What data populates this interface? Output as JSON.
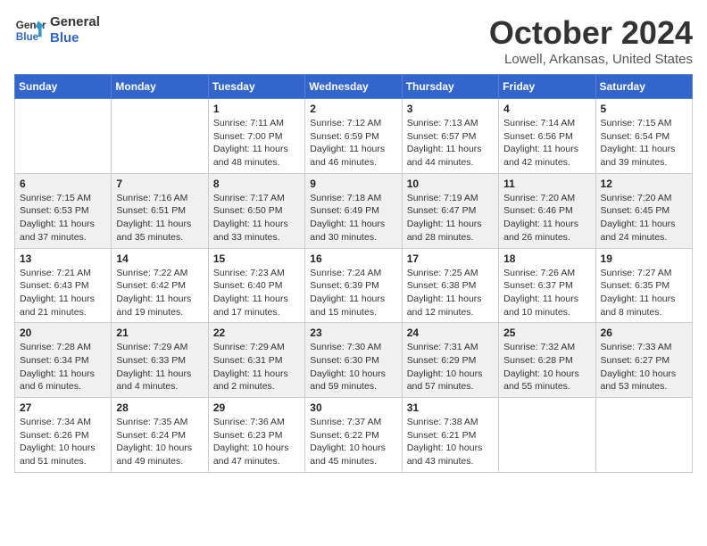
{
  "header": {
    "logo_line1": "General",
    "logo_line2": "Blue",
    "month": "October 2024",
    "location": "Lowell, Arkansas, United States"
  },
  "weekdays": [
    "Sunday",
    "Monday",
    "Tuesday",
    "Wednesday",
    "Thursday",
    "Friday",
    "Saturday"
  ],
  "weeks": [
    [
      {
        "day": "",
        "sunrise": "",
        "sunset": "",
        "daylight": ""
      },
      {
        "day": "",
        "sunrise": "",
        "sunset": "",
        "daylight": ""
      },
      {
        "day": "1",
        "sunrise": "Sunrise: 7:11 AM",
        "sunset": "Sunset: 7:00 PM",
        "daylight": "Daylight: 11 hours and 48 minutes."
      },
      {
        "day": "2",
        "sunrise": "Sunrise: 7:12 AM",
        "sunset": "Sunset: 6:59 PM",
        "daylight": "Daylight: 11 hours and 46 minutes."
      },
      {
        "day": "3",
        "sunrise": "Sunrise: 7:13 AM",
        "sunset": "Sunset: 6:57 PM",
        "daylight": "Daylight: 11 hours and 44 minutes."
      },
      {
        "day": "4",
        "sunrise": "Sunrise: 7:14 AM",
        "sunset": "Sunset: 6:56 PM",
        "daylight": "Daylight: 11 hours and 42 minutes."
      },
      {
        "day": "5",
        "sunrise": "Sunrise: 7:15 AM",
        "sunset": "Sunset: 6:54 PM",
        "daylight": "Daylight: 11 hours and 39 minutes."
      }
    ],
    [
      {
        "day": "6",
        "sunrise": "Sunrise: 7:15 AM",
        "sunset": "Sunset: 6:53 PM",
        "daylight": "Daylight: 11 hours and 37 minutes."
      },
      {
        "day": "7",
        "sunrise": "Sunrise: 7:16 AM",
        "sunset": "Sunset: 6:51 PM",
        "daylight": "Daylight: 11 hours and 35 minutes."
      },
      {
        "day": "8",
        "sunrise": "Sunrise: 7:17 AM",
        "sunset": "Sunset: 6:50 PM",
        "daylight": "Daylight: 11 hours and 33 minutes."
      },
      {
        "day": "9",
        "sunrise": "Sunrise: 7:18 AM",
        "sunset": "Sunset: 6:49 PM",
        "daylight": "Daylight: 11 hours and 30 minutes."
      },
      {
        "day": "10",
        "sunrise": "Sunrise: 7:19 AM",
        "sunset": "Sunset: 6:47 PM",
        "daylight": "Daylight: 11 hours and 28 minutes."
      },
      {
        "day": "11",
        "sunrise": "Sunrise: 7:20 AM",
        "sunset": "Sunset: 6:46 PM",
        "daylight": "Daylight: 11 hours and 26 minutes."
      },
      {
        "day": "12",
        "sunrise": "Sunrise: 7:20 AM",
        "sunset": "Sunset: 6:45 PM",
        "daylight": "Daylight: 11 hours and 24 minutes."
      }
    ],
    [
      {
        "day": "13",
        "sunrise": "Sunrise: 7:21 AM",
        "sunset": "Sunset: 6:43 PM",
        "daylight": "Daylight: 11 hours and 21 minutes."
      },
      {
        "day": "14",
        "sunrise": "Sunrise: 7:22 AM",
        "sunset": "Sunset: 6:42 PM",
        "daylight": "Daylight: 11 hours and 19 minutes."
      },
      {
        "day": "15",
        "sunrise": "Sunrise: 7:23 AM",
        "sunset": "Sunset: 6:40 PM",
        "daylight": "Daylight: 11 hours and 17 minutes."
      },
      {
        "day": "16",
        "sunrise": "Sunrise: 7:24 AM",
        "sunset": "Sunset: 6:39 PM",
        "daylight": "Daylight: 11 hours and 15 minutes."
      },
      {
        "day": "17",
        "sunrise": "Sunrise: 7:25 AM",
        "sunset": "Sunset: 6:38 PM",
        "daylight": "Daylight: 11 hours and 12 minutes."
      },
      {
        "day": "18",
        "sunrise": "Sunrise: 7:26 AM",
        "sunset": "Sunset: 6:37 PM",
        "daylight": "Daylight: 11 hours and 10 minutes."
      },
      {
        "day": "19",
        "sunrise": "Sunrise: 7:27 AM",
        "sunset": "Sunset: 6:35 PM",
        "daylight": "Daylight: 11 hours and 8 minutes."
      }
    ],
    [
      {
        "day": "20",
        "sunrise": "Sunrise: 7:28 AM",
        "sunset": "Sunset: 6:34 PM",
        "daylight": "Daylight: 11 hours and 6 minutes."
      },
      {
        "day": "21",
        "sunrise": "Sunrise: 7:29 AM",
        "sunset": "Sunset: 6:33 PM",
        "daylight": "Daylight: 11 hours and 4 minutes."
      },
      {
        "day": "22",
        "sunrise": "Sunrise: 7:29 AM",
        "sunset": "Sunset: 6:31 PM",
        "daylight": "Daylight: 11 hours and 2 minutes."
      },
      {
        "day": "23",
        "sunrise": "Sunrise: 7:30 AM",
        "sunset": "Sunset: 6:30 PM",
        "daylight": "Daylight: 10 hours and 59 minutes."
      },
      {
        "day": "24",
        "sunrise": "Sunrise: 7:31 AM",
        "sunset": "Sunset: 6:29 PM",
        "daylight": "Daylight: 10 hours and 57 minutes."
      },
      {
        "day": "25",
        "sunrise": "Sunrise: 7:32 AM",
        "sunset": "Sunset: 6:28 PM",
        "daylight": "Daylight: 10 hours and 55 minutes."
      },
      {
        "day": "26",
        "sunrise": "Sunrise: 7:33 AM",
        "sunset": "Sunset: 6:27 PM",
        "daylight": "Daylight: 10 hours and 53 minutes."
      }
    ],
    [
      {
        "day": "27",
        "sunrise": "Sunrise: 7:34 AM",
        "sunset": "Sunset: 6:26 PM",
        "daylight": "Daylight: 10 hours and 51 minutes."
      },
      {
        "day": "28",
        "sunrise": "Sunrise: 7:35 AM",
        "sunset": "Sunset: 6:24 PM",
        "daylight": "Daylight: 10 hours and 49 minutes."
      },
      {
        "day": "29",
        "sunrise": "Sunrise: 7:36 AM",
        "sunset": "Sunset: 6:23 PM",
        "daylight": "Daylight: 10 hours and 47 minutes."
      },
      {
        "day": "30",
        "sunrise": "Sunrise: 7:37 AM",
        "sunset": "Sunset: 6:22 PM",
        "daylight": "Daylight: 10 hours and 45 minutes."
      },
      {
        "day": "31",
        "sunrise": "Sunrise: 7:38 AM",
        "sunset": "Sunset: 6:21 PM",
        "daylight": "Daylight: 10 hours and 43 minutes."
      },
      {
        "day": "",
        "sunrise": "",
        "sunset": "",
        "daylight": ""
      },
      {
        "day": "",
        "sunrise": "",
        "sunset": "",
        "daylight": ""
      }
    ]
  ]
}
